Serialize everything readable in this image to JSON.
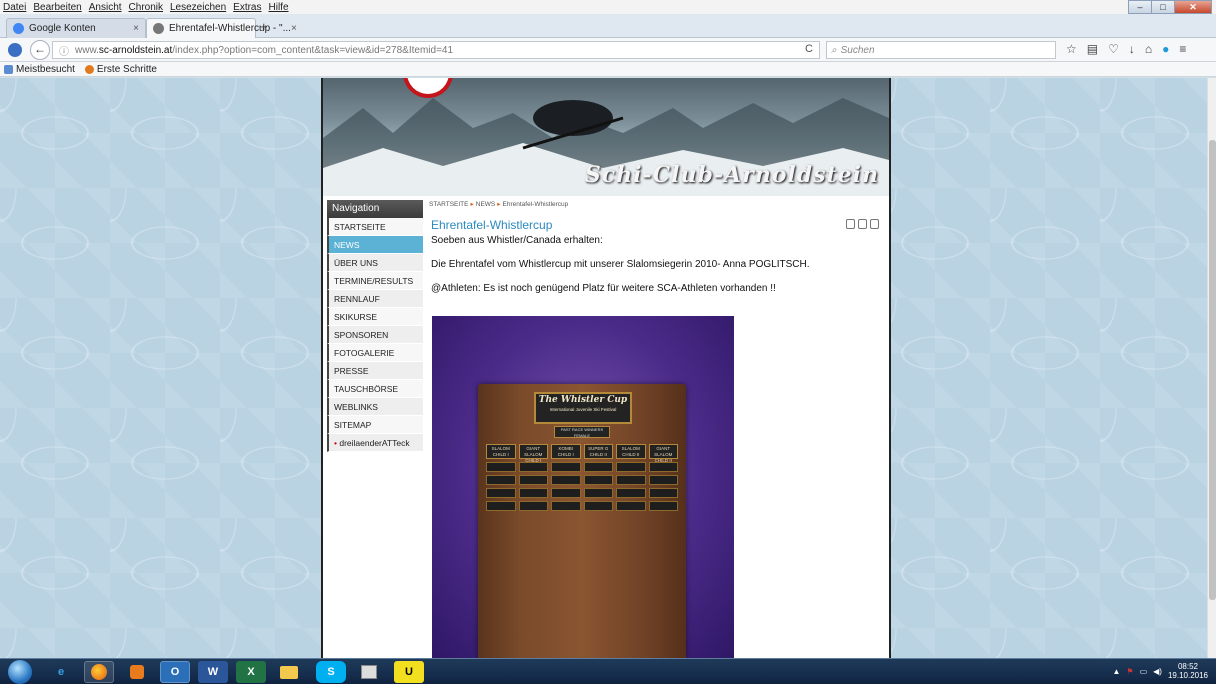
{
  "menubar": [
    "Datei",
    "Bearbeiten",
    "Ansicht",
    "Chronik",
    "Lesezeichen",
    "Extras",
    "Hilfe"
  ],
  "tabs": [
    {
      "label": "Google Konten",
      "close": "×",
      "active": false
    },
    {
      "label": "Ehrentafel-Whistlercup - \"...",
      "close": "×",
      "active": true
    }
  ],
  "new_tab": "+",
  "url": {
    "info": "ⓘ",
    "prefix": "www.",
    "host": "sc-arnoldstein.at",
    "path": "/index.php?option=com_content&task=view&id=278&Itemid=41",
    "reload": "C"
  },
  "search": {
    "placeholder": "Suchen"
  },
  "bookmarks": [
    "Meistbesucht",
    "Erste Schritte"
  ],
  "site": {
    "banner_title": "Schi-Club-Arnoldstein",
    "nav_heading": "Navigation",
    "nav_items": [
      "STARTSEITE",
      "NEWS",
      "ÜBER UNS",
      "TERMINE/RESULTS",
      "RENNLAUF",
      "SKIKURSE",
      "SPONSOREN",
      "FOTOGALERIE",
      "PRESSE",
      "TAUSCHBÖRSE",
      "WEBLINKS",
      "SITEMAP",
      "dreilaenderATTeck"
    ],
    "breadcrumb": [
      "STARTSEITE",
      "NEWS",
      "Ehrentafel-Whistlercup"
    ],
    "article": {
      "title": "Ehrentafel-Whistlercup",
      "intro": "Soeben aus Whistler/Canada erhalten:",
      "line1": "Die Ehrentafel vom Whistlercup mit unserer Slalomsiegerin 2010- Anna POGLITSCH.",
      "line2": "@Athleten: Es ist noch genügend Platz für weitere SCA-Athleten vorhanden !!"
    },
    "plaque": {
      "title": "The Whistler Cup",
      "subtitle": "International Juvenile Ski Festival",
      "header": "PAST RACE WINNERS FEMALE",
      "columns": [
        "SLALOM CHILD I",
        "GIANT SLALOM CHILD I",
        "KOMBI CHILD I",
        "SUPER G CHILD II",
        "SLALOM CHILD II",
        "GIANT SLALOM CHILD II"
      ]
    }
  },
  "taskbar": {
    "time": "08:52",
    "date": "19.10.2016"
  }
}
